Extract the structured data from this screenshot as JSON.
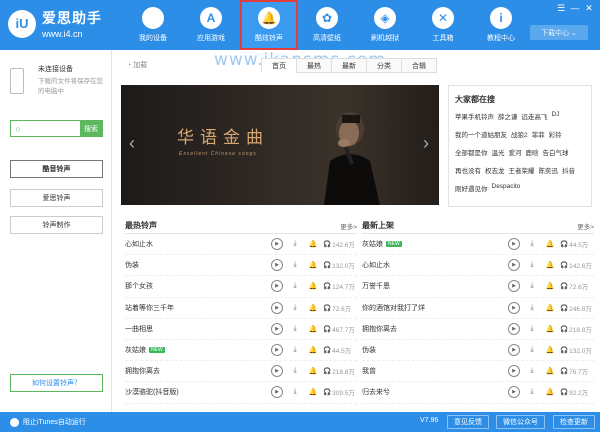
{
  "app": {
    "name": "爱思助手",
    "url": "www.i4.cn",
    "logo_mark": "iU",
    "download_center": "下载中心"
  },
  "nav": [
    {
      "label": "我的设备",
      "icon": "apple-icon",
      "glyph": ""
    },
    {
      "label": "应用游戏",
      "icon": "app-store-icon",
      "glyph": "A"
    },
    {
      "label": "酷炫铃声",
      "icon": "bell-icon",
      "glyph": "🔔"
    },
    {
      "label": "高清壁纸",
      "icon": "flower-icon",
      "glyph": "✿"
    },
    {
      "label": "刷机越狱",
      "icon": "box-icon",
      "glyph": "◈"
    },
    {
      "label": "工具箱",
      "icon": "tools-icon",
      "glyph": "✕"
    },
    {
      "label": "教程中心",
      "icon": "info-icon",
      "glyph": "i"
    }
  ],
  "watermark": "www.ikansms.com",
  "sidebar": {
    "device_title": "未连接设备",
    "device_desc": "下载的文件将保存在您的电脑中",
    "search_placeholder": "",
    "search_button": "搜索",
    "menu": [
      "酷音铃声",
      "爱思铃声",
      "铃声制作"
    ],
    "help": "如何设置铃声？"
  },
  "tabs": {
    "loading": "加载",
    "items": [
      "首页",
      "最热",
      "最新",
      "分类",
      "合辑"
    ]
  },
  "banner": {
    "title": "华语金曲",
    "subtitle": "Excellent Chinese songs"
  },
  "hot_search": {
    "title": "大家都在搜",
    "tags": [
      "苹果手机铃声",
      "薛之谦",
      "远走高飞",
      "DJ",
      "我的一个道姑朋友",
      "战狼2",
      "菲菲",
      "彩铃",
      "全部都是你",
      "温光",
      "爱河",
      "鹿晗",
      "告白气球",
      "再也没有",
      "权志龙",
      "王者荣耀",
      "陈奕迅",
      "抖音",
      "刚好遇见你",
      "Despacito"
    ]
  },
  "hot_list": {
    "title": "最热铃声",
    "more": "更多>",
    "songs": [
      {
        "name": "心如止水",
        "count": "142.6万",
        "new": false
      },
      {
        "name": "伪装",
        "count": "132.0万",
        "new": false
      },
      {
        "name": "那个女孩",
        "count": "124.7万",
        "new": false
      },
      {
        "name": "站着等你三千年",
        "count": "72.6万",
        "new": false
      },
      {
        "name": "一曲相思",
        "count": "467.7万",
        "new": false
      },
      {
        "name": "灰姑娘",
        "count": "44.5万",
        "new": true
      },
      {
        "name": "拥抱你离去",
        "count": "218.8万",
        "new": false
      },
      {
        "name": "沙漠骆驼(抖音版)",
        "count": "309.5万",
        "new": false
      }
    ]
  },
  "new_list": {
    "title": "最新上架",
    "more": "更多>",
    "songs": [
      {
        "name": "灰姑娘",
        "count": "44.5万",
        "new": true
      },
      {
        "name": "心如止水",
        "count": "142.6万",
        "new": false
      },
      {
        "name": "万誉千恩",
        "count": "72.6万",
        "new": false
      },
      {
        "name": "你的酒馆对我打了烊",
        "count": "246.8万",
        "new": false
      },
      {
        "name": "拥抱你离去",
        "count": "218.8万",
        "new": false
      },
      {
        "name": "伪装",
        "count": "132.0万",
        "new": false
      },
      {
        "name": "我曾",
        "count": "76.7万",
        "new": false
      },
      {
        "name": "归去来兮",
        "count": "92.2万",
        "new": false
      }
    ]
  },
  "new_badge": "NEW",
  "footer": {
    "itunes": "阻止iTunes自动运行",
    "version": "V7.96",
    "feedback": "意见反馈",
    "wechat": "微信公众号",
    "update": "检查更新"
  },
  "colors": {
    "brand": "#2d8ee8",
    "accent_green": "#5cb85c",
    "active_outline": "#e23c3c"
  }
}
